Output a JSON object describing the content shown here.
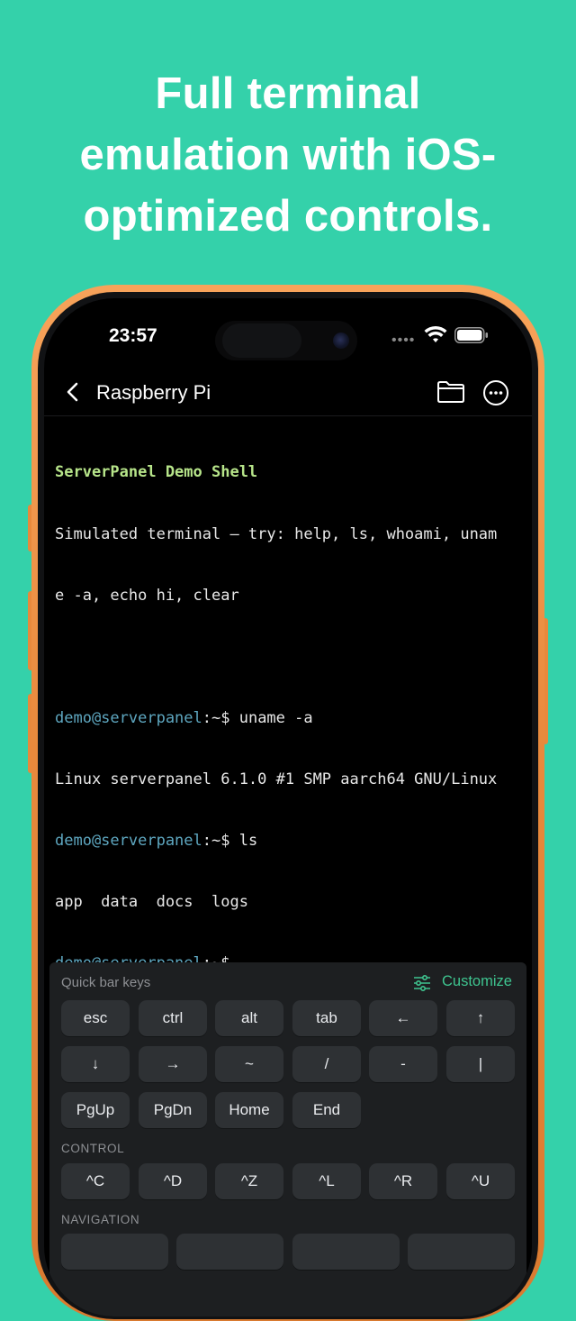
{
  "headline": {
    "lines": [
      "Full terminal",
      "emulation with iOS-",
      "optimized controls."
    ]
  },
  "status_bar": {
    "time": "23:57",
    "dots": "••••"
  },
  "nav": {
    "title": "Raspberry Pi"
  },
  "terminal": {
    "heading": "ServerPanel Demo Shell",
    "intro_1": "Simulated terminal — try: help, ls, whoami, unam",
    "intro_2": "e -a, echo hi, clear",
    "prompt": "demo@serverpanel",
    "prompt_suffix": ":~$",
    "cmd_uname": " uname -a",
    "out_uname": "Linux serverpanel 6.1.0 #1 SMP aarch64 GNU/Linux",
    "cmd_ls": " ls",
    "out_ls": "app  data  docs  logs"
  },
  "quickbar": {
    "label": "Quick bar keys",
    "customize": "Customize",
    "row1": [
      "esc",
      "ctrl",
      "alt",
      "tab",
      "←",
      "↑"
    ],
    "row2": [
      "↓",
      "→",
      "~",
      "/",
      "-",
      "|"
    ],
    "row3": [
      "PgUp",
      "PgDn",
      "Home",
      "End"
    ],
    "control_label": "CONTROL",
    "control": [
      "^C",
      "^D",
      "^Z",
      "^L",
      "^R",
      "^U"
    ],
    "navigation_label": "NAVIGATION"
  },
  "colors": {
    "background": "#34d1aa",
    "accent": "#3ec48f",
    "prompt": "#5ea7c0",
    "heading": "#b7e58a"
  }
}
